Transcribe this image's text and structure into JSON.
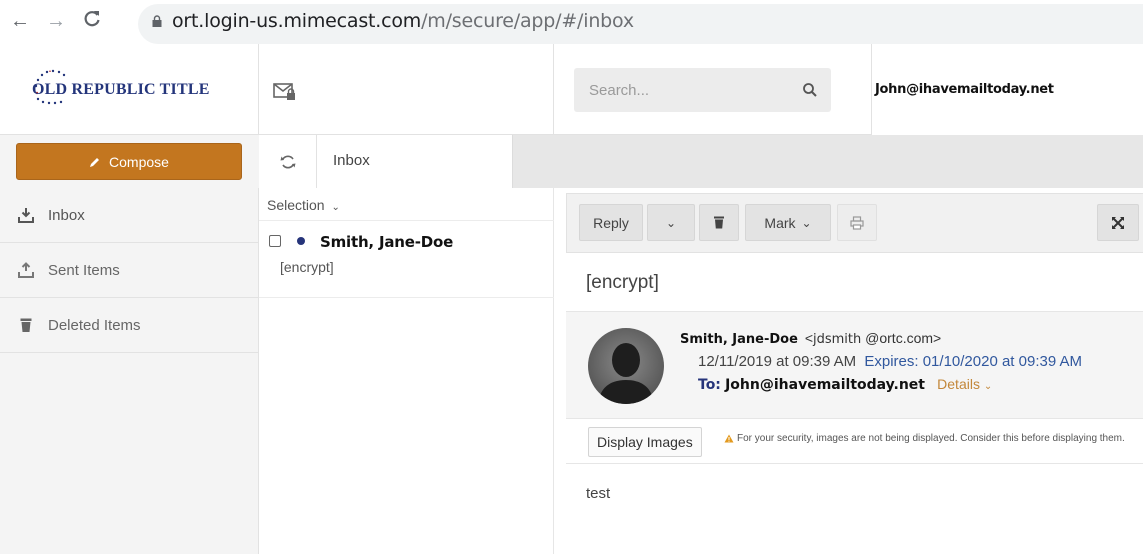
{
  "browser": {
    "url_host": "ort.login-us.mimecast.com",
    "url_path": "/m/secure/app/#/inbox"
  },
  "header": {
    "logo_text": "OLD REPUBLIC TITLE",
    "search_placeholder": "Search...",
    "user_email": "John@ihavemailtoday.net"
  },
  "compose": {
    "label": "Compose"
  },
  "tabs": {
    "inbox_label": "Inbox"
  },
  "sidebar": {
    "items": [
      {
        "label": "Inbox",
        "icon": "inbox-tray-icon"
      },
      {
        "label": "Sent Items",
        "icon": "outbox-tray-icon"
      },
      {
        "label": "Deleted Items",
        "icon": "trash-icon"
      }
    ]
  },
  "list": {
    "selection_label": "Selection",
    "messages": [
      {
        "sender": "Smith, Jane-Doe",
        "subject": "[encrypt]",
        "unread": true
      }
    ]
  },
  "toolbar": {
    "reply_label": "Reply",
    "mark_label": "Mark"
  },
  "message": {
    "subject": "[encrypt]",
    "from_name": "Smith, Jane-Doe",
    "from_lt": "<",
    "from_user": "jdsmith",
    "from_domain": "@ortc.com>",
    "date": "12/11/2019 at 09:39 AM",
    "expires": "Expires: 01/10/2020 at 09:39 AM",
    "to_label": "To:",
    "to_address": "John@ihavemailtoday.net",
    "details_label": "Details",
    "display_images_label": "Display Images",
    "security_notice": "For your security, images are not being displayed. Consider this before displaying them.",
    "body": "test"
  },
  "colors": {
    "accent": "#c3761f",
    "brand_blue": "#24357b",
    "link_blue": "#31589e"
  }
}
